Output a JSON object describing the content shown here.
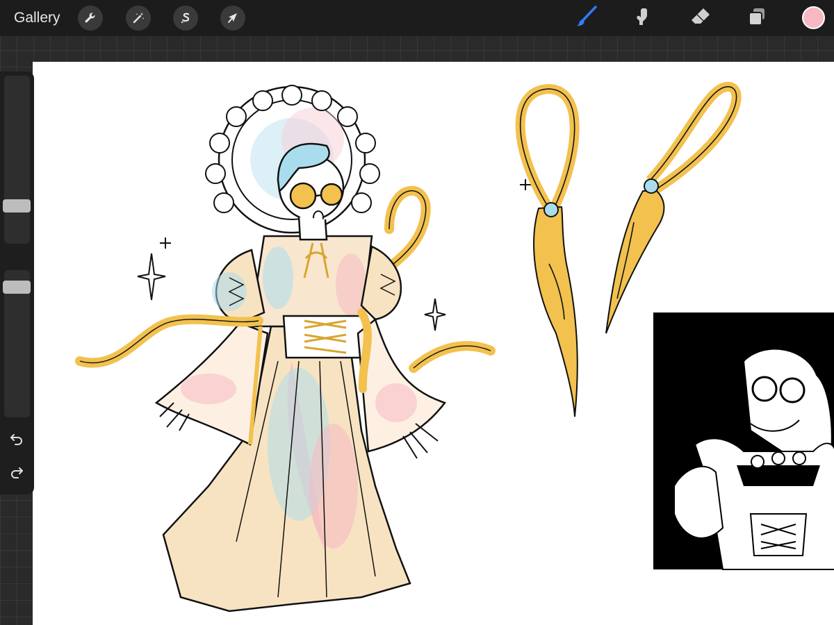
{
  "toolbar": {
    "gallery_label": "Gallery",
    "left_tools": [
      {
        "icon": "wrench-icon",
        "name": "actions"
      },
      {
        "icon": "magic-wand-icon",
        "name": "adjustments"
      },
      {
        "icon": "selection-s-icon",
        "name": "selection"
      },
      {
        "icon": "arrow-cursor-icon",
        "name": "transform"
      }
    ],
    "right_tools": [
      {
        "icon": "brush-icon",
        "name": "brush",
        "active": true
      },
      {
        "icon": "smudge-icon",
        "name": "smudge",
        "active": false
      },
      {
        "icon": "eraser-icon",
        "name": "eraser",
        "active": false
      },
      {
        "icon": "layers-icon",
        "name": "layers",
        "active": false
      }
    ],
    "current_color": "#f7b8c4",
    "active_tool_color": "#2f7cf6"
  },
  "sidebar": {
    "controls": [
      "brush-size-slider",
      "modify-button",
      "opacity-slider",
      "undo-button",
      "redo-button"
    ]
  },
  "canvas": {
    "colors": {
      "gold": "#f2c14e",
      "gold_dark": "#d9a530",
      "cyan": "#a9ddee",
      "pink": "#f6b9c3",
      "cream": "#f7e3c2",
      "ink": "#111111"
    }
  }
}
